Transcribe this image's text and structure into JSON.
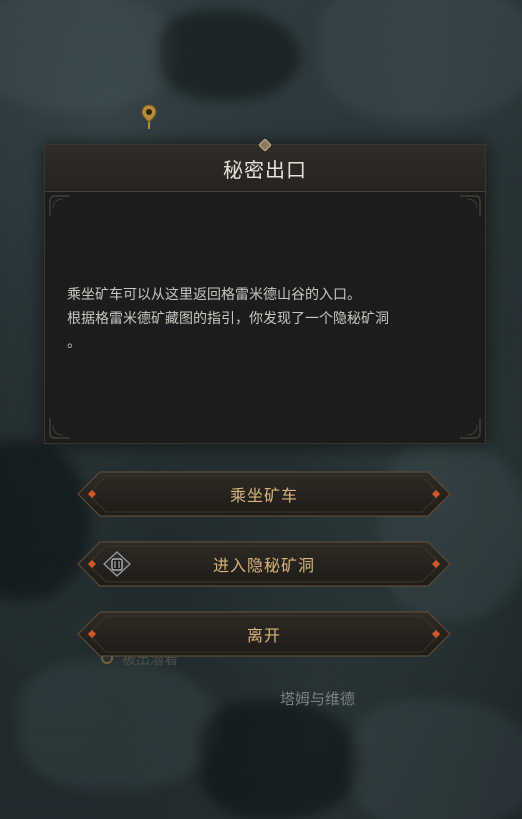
{
  "dialog": {
    "title": "秘密出口",
    "body_line_1": "乘坐矿车可以从这里返回格雷米德山谷的入口。",
    "body_line_2": "根据格雷米德矿藏图的指引，你发现了一个隐秘矿洞",
    "body_line_3": "。"
  },
  "options": [
    {
      "label": "乘坐矿车",
      "icon": null
    },
    {
      "label": "进入隐秘矿洞",
      "icon": "cave-entrance-icon"
    },
    {
      "label": "离开",
      "icon": null
    }
  ],
  "map": {
    "label_bottom": "塔姆与维德",
    "label_faded": "被出潜着",
    "marker_icon": "map-pin-icon"
  },
  "colors": {
    "accent_gold": "#d7b57c",
    "accent_red": "#d4572c",
    "dialog_bg": "#1c1c1d",
    "title_text": "#e6e2da"
  }
}
